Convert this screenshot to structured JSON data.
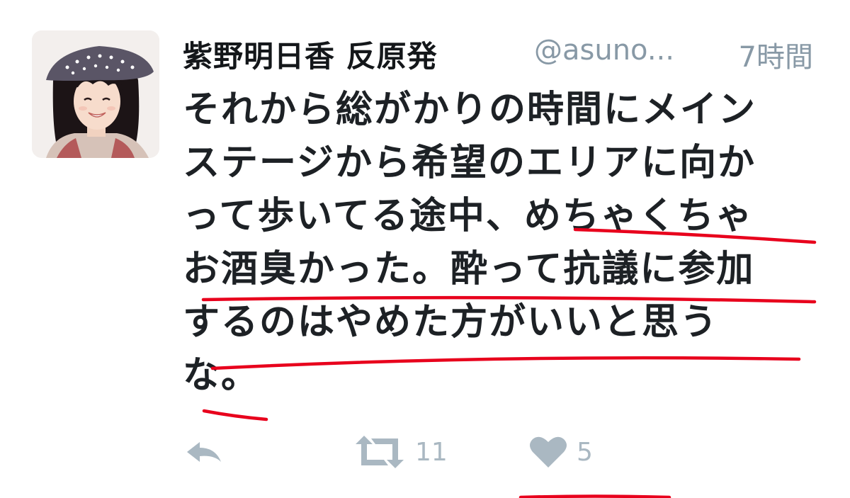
{
  "tweet": {
    "display_name": "紫野明日香 反原発",
    "handle": "@asuno...",
    "time": "7時間",
    "text_lines": [
      "それから総がかりの時間にメイン",
      "ステージから希望のエリアに向か",
      "って歩いてる途中、めちゃくちゃ",
      "お酒臭かった。酔って抗議に参加",
      "するのはやめた方がいいと思う",
      "な。"
    ],
    "actions": {
      "reply_icon": "reply-icon",
      "retweet_icon": "retweet-icon",
      "retweet_count": "11",
      "like_icon": "heart-icon",
      "like_count": "5"
    }
  },
  "colors": {
    "name": "#14171a",
    "meta": "#8899a6",
    "text": "#1d2125",
    "action": "#aab8c2",
    "annotation": "#e8001c"
  }
}
